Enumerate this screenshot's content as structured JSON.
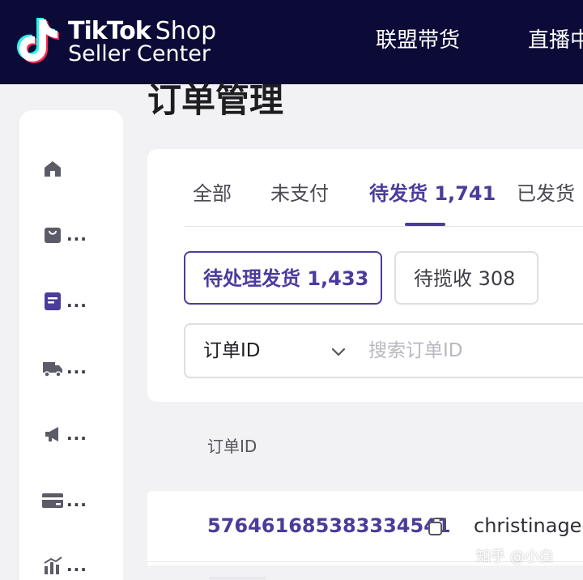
{
  "colors": {
    "topbar_bg": "#0c0b38",
    "accent": "#4b3c9b",
    "tiktok_cyan": "#25f4ee",
    "tiktok_pink": "#fe2c55"
  },
  "header": {
    "brand_tiktok": "TikTok",
    "brand_shop": "Shop",
    "brand_seller_center": "Seller Center",
    "nav": {
      "affiliate": "联盟带货",
      "live": "直播中"
    }
  },
  "sidebar": {
    "items": [
      {
        "icon": "home-icon",
        "more": ""
      },
      {
        "icon": "shopping-bag-icon",
        "more": "..."
      },
      {
        "icon": "orders-icon",
        "more": "...",
        "active": true
      },
      {
        "icon": "truck-icon",
        "more": "..."
      },
      {
        "icon": "megaphone-icon",
        "more": "..."
      },
      {
        "icon": "credit-card-icon",
        "more": "..."
      },
      {
        "icon": "bar-chart-icon",
        "more": "..."
      }
    ]
  },
  "main": {
    "page_title": "订单管理",
    "tabs": [
      {
        "label": "全部"
      },
      {
        "label": "未支付"
      },
      {
        "label": "待发货 1,741",
        "active": true
      },
      {
        "label": "已发货"
      }
    ],
    "filters": [
      {
        "label": "待处理发货 1,433",
        "active": true
      },
      {
        "label": "待揽收 308"
      }
    ],
    "search": {
      "type_label": "订单ID",
      "placeholder": "搜索订单ID",
      "value": ""
    },
    "table": {
      "columns": [
        "订单ID"
      ],
      "rows": [
        {
          "order_id": "576461685383334541",
          "buyer": "christinagec"
        }
      ]
    }
  },
  "watermark": "知乎 @小白"
}
